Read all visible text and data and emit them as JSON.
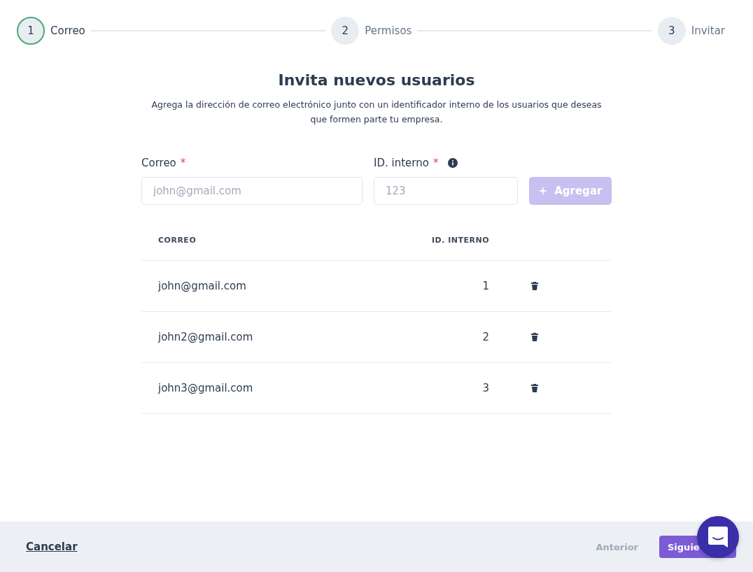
{
  "steps": [
    {
      "number": "1",
      "label": "Correo",
      "selected": true
    },
    {
      "number": "2",
      "label": "Permisos",
      "selected": false
    },
    {
      "number": "3",
      "label": "Invitar",
      "selected": false
    }
  ],
  "heading": {
    "title": "Invita nuevos usuarios",
    "description": "Agrega la dirección de correo electrónico junto con un identificador interno de los usuarios que deseas que formen parte tu empresa."
  },
  "form": {
    "email": {
      "label": "Correo",
      "required_mark": "*",
      "placeholder": "john@gmail.com"
    },
    "internal_id": {
      "label": "ID. interno",
      "required_mark": "*",
      "placeholder": "123"
    },
    "add_button": {
      "icon": "+",
      "label": "Agregar",
      "disabled": true
    }
  },
  "table": {
    "columns": [
      "CORREO",
      "ID. INTERNO"
    ],
    "rows": [
      {
        "email": "john@gmail.com",
        "internal_id": "1"
      },
      {
        "email": "john2@gmail.com",
        "internal_id": "2"
      },
      {
        "email": "john3@gmail.com",
        "internal_id": "3"
      }
    ]
  },
  "footer": {
    "cancel": "Cancelar",
    "previous": {
      "label": "Anterior",
      "disabled": true
    },
    "next": {
      "label": "Siguie",
      "disabled": false
    }
  }
}
